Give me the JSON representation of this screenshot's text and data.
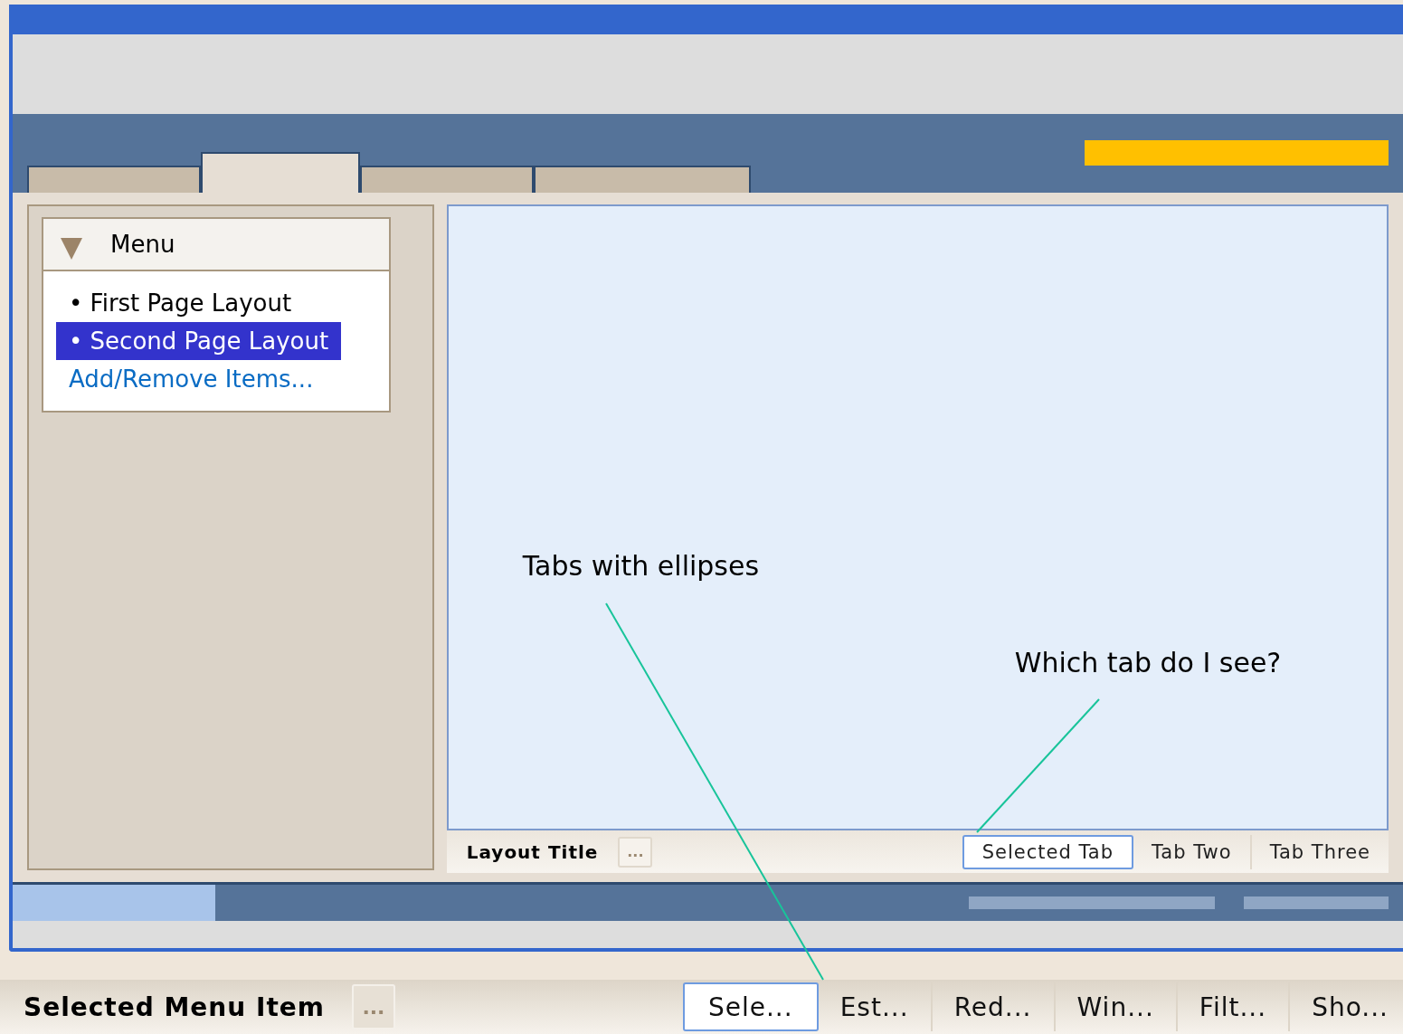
{
  "top_tabs": [
    {
      "selected": false
    },
    {
      "selected": true
    },
    {
      "selected": false
    },
    {
      "selected": false
    }
  ],
  "menu": {
    "title": "Menu",
    "expanded": true,
    "items": [
      {
        "kind": "item",
        "label": "• First Page Layout",
        "selected": false
      },
      {
        "kind": "item",
        "label": "• Second Page Layout",
        "selected": true
      },
      {
        "kind": "link",
        "label": "Add/Remove Items...",
        "selected": false
      }
    ]
  },
  "annotations": [
    {
      "text": "Tabs with ellipses"
    },
    {
      "text": "Which tab do I see?"
    }
  ],
  "layout_footer": {
    "title": "Layout Title",
    "more_button": "...",
    "tabs": [
      {
        "label": "Selected Tab",
        "selected": true
      },
      {
        "label": "Tab Two",
        "selected": false
      },
      {
        "label": "Tab Three",
        "selected": false
      }
    ]
  },
  "bottom_bar": {
    "title": "Selected Menu Item",
    "more_button": "...",
    "tabs": [
      {
        "label": "Sele...",
        "selected": true
      },
      {
        "label": "Est...",
        "selected": false
      },
      {
        "label": "Red...",
        "selected": false
      },
      {
        "label": "Win...",
        "selected": false
      },
      {
        "label": "Filt...",
        "selected": false
      },
      {
        "label": "Sho...",
        "selected": false
      }
    ]
  }
}
